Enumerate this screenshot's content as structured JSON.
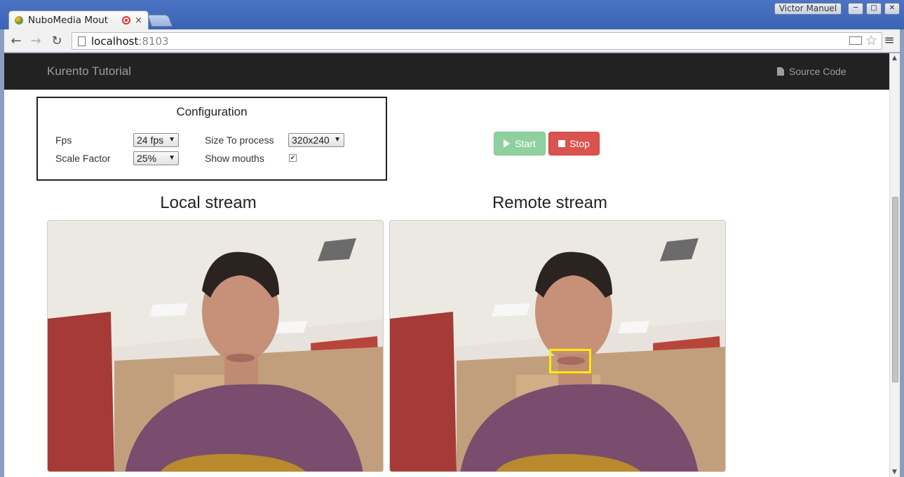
{
  "browser": {
    "tab_title": "NuboMedia Mout",
    "close_glyph": "×",
    "user_name": "Victor Manuel",
    "url_host": "localhost",
    "url_port": ":8103"
  },
  "navbar": {
    "brand": "Kurento Tutorial",
    "source_code": "Source Code"
  },
  "config": {
    "title": "Configuration",
    "fps_label": "Fps",
    "fps_value": "24 fps",
    "size_label": "Size To process",
    "size_value": "320x240",
    "scale_label": "Scale Factor",
    "scale_value": "25%",
    "mouths_label": "Show mouths",
    "show_mouths": true
  },
  "controls": {
    "start_label": "Start",
    "stop_label": "Stop"
  },
  "streams": {
    "local_title": "Local stream",
    "remote_title": "Remote stream"
  },
  "colors": {
    "start_button": "#8fd19e",
    "stop_button": "#d9534f",
    "navbar_bg": "#222222",
    "mouth_box": "#ffeb00"
  }
}
